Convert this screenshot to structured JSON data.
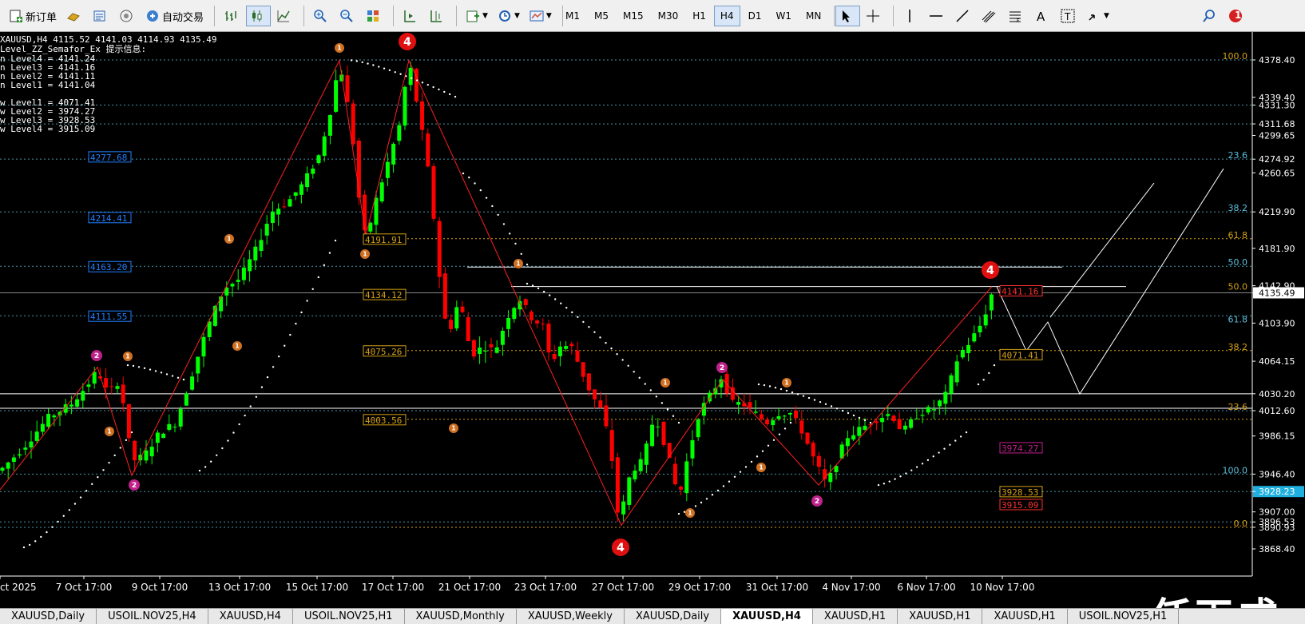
{
  "toolbar": {
    "new_order": "新订单",
    "auto_trade": "自动交易",
    "timeframes": [
      "M1",
      "M5",
      "M15",
      "M30",
      "H1",
      "H4",
      "D1",
      "W1",
      "MN"
    ],
    "active_timeframe": "H4",
    "notification_count": "1"
  },
  "chart": {
    "header": "XAUUSD,H4  4115.52 4141.03 4114.93 4135.49",
    "indicator_title": "Level_ZZ_Semafor_Ex 提示信息:",
    "levels_info": [
      "n Level4 = 4141.24",
      "n Level3 = 4141.16",
      "n Level2 = 4141.11",
      "n Level1 = 4141.04",
      "",
      "w Level1 = 4071.41",
      "w Level2 = 3974.27",
      "w Level3 = 3928.53",
      "w Level4 = 3915.09"
    ],
    "price_labels": [
      "4378.40",
      "4339.40",
      "4331.30",
      "4311.68",
      "4299.65",
      "4274.92",
      "4260.65",
      "4219.90",
      "4181.90",
      "4142.90",
      "4135.49",
      "4103.90",
      "4064.15",
      "4030.20",
      "4012.60",
      "3986.15",
      "3946.40",
      "3928.23",
      "3907.00",
      "3896.53",
      "3890.93",
      "3868.40"
    ],
    "highlight_prices": {
      "current": "4135.49",
      "cyan": "3928.23"
    },
    "left_level_labels": [
      "4277.68",
      "4214.41",
      "4163.20",
      "4111.55"
    ],
    "zz_labels": [
      "4191.91",
      "4134.12",
      "4075.26",
      "4003.56"
    ],
    "right_boxes": [
      "4141.16",
      "4071.41",
      "3974.27",
      "3928.53",
      "3915.09"
    ],
    "fib_top": [
      "100.0",
      "23.6",
      "38.2",
      "61.8",
      "50.0",
      "50.0",
      "61.8",
      "38.2"
    ],
    "fib_bottom": [
      "23.6",
      "100.0",
      "0.0"
    ],
    "time_labels": [
      "ct 2025",
      "7 Oct 17:00",
      "9 Oct 17:00",
      "13 Oct 17:00",
      "15 Oct 17:00",
      "17 Oct 17:00",
      "21 Oct 17:00",
      "23 Oct 17:00",
      "27 Oct 17:00",
      "29 Oct 17:00",
      "31 Oct 17:00",
      "4 Nov 17:00",
      "6 Nov 17:00",
      "10 Nov 17:00"
    ],
    "watermark": "任天成"
  },
  "tabs": [
    "XAUUSD,Daily",
    "USOIL.NOV25,H4",
    "XAUUSD,H4",
    "USOIL.NOV25,H1",
    "XAUUSD,Monthly",
    "XAUUSD,Weekly",
    "XAUUSD,Daily",
    "XAUUSD,H4",
    "XAUUSD,H1",
    "XAUUSD,H1",
    "XAUUSD,H1",
    "USOIL.NOV25,H1"
  ],
  "active_tab_index": 7,
  "colors": {
    "bull": "#00ff00",
    "bear": "#ff0000",
    "zigzag": "#ff2020",
    "fib": "#d4a017",
    "level_line": "#5bc0de"
  }
}
